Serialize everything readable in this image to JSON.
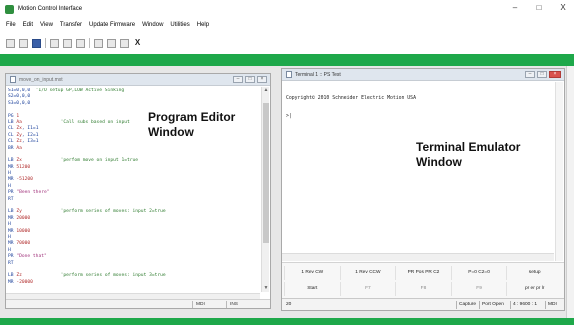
{
  "window": {
    "title": "Motion Control Interface",
    "controls": [
      "–",
      "□",
      "X"
    ]
  },
  "menu": [
    "File",
    "Edit",
    "View",
    "Transfer",
    "Update Firmware",
    "Window",
    "Utilities",
    "Help"
  ],
  "toolbar": {
    "close_label": "X"
  },
  "editor": {
    "title": "move_on_input.mxt",
    "lines": [
      [
        {
          "c": "kw",
          "t": "S1=0,0,0  "
        },
        {
          "c": "cm",
          "t": "'I/O setup GP,LOW Active Sinking"
        }
      ],
      [
        {
          "c": "kw",
          "t": "S2=0,0,0"
        }
      ],
      [
        {
          "c": "kw",
          "t": "S3=0,0,0"
        }
      ],
      [
        {
          "c": "kw",
          "t": ""
        }
      ],
      [
        {
          "c": "kw",
          "t": "PG "
        },
        {
          "c": "val",
          "t": "1"
        }
      ],
      [
        {
          "c": "kw",
          "t": "LB "
        },
        {
          "c": "val",
          "t": "Aa"
        },
        {
          "c": "kw",
          "t": "              "
        },
        {
          "c": "cm",
          "t": "'Call subs based on input"
        }
      ],
      [
        {
          "c": "kw",
          "t": "CL "
        },
        {
          "c": "val",
          "t": "Zx"
        },
        {
          "c": "kw",
          "t": ", I1=1"
        }
      ],
      [
        {
          "c": "kw",
          "t": "CL "
        },
        {
          "c": "val",
          "t": "Zy"
        },
        {
          "c": "kw",
          "t": ", I2=1"
        }
      ],
      [
        {
          "c": "kw",
          "t": "CL "
        },
        {
          "c": "val",
          "t": "Zz"
        },
        {
          "c": "kw",
          "t": ", I3=1"
        }
      ],
      [
        {
          "c": "kw",
          "t": "BR "
        },
        {
          "c": "val",
          "t": "Aa"
        }
      ],
      [
        {
          "c": "kw",
          "t": ""
        }
      ],
      [
        {
          "c": "kw",
          "t": "LB "
        },
        {
          "c": "val",
          "t": "Zx"
        },
        {
          "c": "kw",
          "t": "              "
        },
        {
          "c": "cm",
          "t": "'perfom move on input 1=true"
        }
      ],
      [
        {
          "c": "kw",
          "t": "MR "
        },
        {
          "c": "val",
          "t": "51200"
        }
      ],
      [
        {
          "c": "kw",
          "t": "H"
        }
      ],
      [
        {
          "c": "kw",
          "t": "MR "
        },
        {
          "c": "val",
          "t": "-51200"
        }
      ],
      [
        {
          "c": "kw",
          "t": "H"
        }
      ],
      [
        {
          "c": "kw",
          "t": "PR "
        },
        {
          "c": "str",
          "t": "\"Been there\""
        }
      ],
      [
        {
          "c": "kw",
          "t": "RT"
        }
      ],
      [
        {
          "c": "kw",
          "t": ""
        }
      ],
      [
        {
          "c": "kw",
          "t": "LB "
        },
        {
          "c": "val",
          "t": "Zy"
        },
        {
          "c": "kw",
          "t": "              "
        },
        {
          "c": "cm",
          "t": "'perform series of moves: input 2=true"
        }
      ],
      [
        {
          "c": "kw",
          "t": "MR "
        },
        {
          "c": "val",
          "t": "20000"
        }
      ],
      [
        {
          "c": "kw",
          "t": "H"
        }
      ],
      [
        {
          "c": "kw",
          "t": "MR "
        },
        {
          "c": "val",
          "t": "10000"
        }
      ],
      [
        {
          "c": "kw",
          "t": "H"
        }
      ],
      [
        {
          "c": "kw",
          "t": "MR "
        },
        {
          "c": "val",
          "t": "70000"
        }
      ],
      [
        {
          "c": "kw",
          "t": "H"
        }
      ],
      [
        {
          "c": "kw",
          "t": "PR "
        },
        {
          "c": "str",
          "t": "\"Done that\""
        }
      ],
      [
        {
          "c": "kw",
          "t": "RT"
        }
      ],
      [
        {
          "c": "kw",
          "t": ""
        }
      ],
      [
        {
          "c": "kw",
          "t": "LB "
        },
        {
          "c": "val",
          "t": "Zz"
        },
        {
          "c": "kw",
          "t": "              "
        },
        {
          "c": "cm",
          "t": "'perform series of moves: input 3=true"
        }
      ],
      [
        {
          "c": "kw",
          "t": "MR "
        },
        {
          "c": "val",
          "t": "-20000"
        }
      ]
    ],
    "status": {
      "mode": "MDI",
      "ins": "INS"
    }
  },
  "labels": {
    "program_editor_line1": "Program Editor",
    "program_editor_line2": "Window",
    "terminal_emulator_line1": "Terminal Emulator",
    "terminal_emulator_line2": "Window"
  },
  "terminal": {
    "title": "Terminal 1 :: PS Test",
    "output_line1": "Copyright© 2010 Schneider Electric Motion USA",
    "output_line2": ">|",
    "fkeys_row1": [
      "1 Rev CW",
      "1 Rev CCW",
      "PR Pos PR C2",
      "P=0 C2=0",
      "setup"
    ],
    "fkeys_row2": [
      "Start",
      "F7",
      "F8",
      "F9",
      "pr er pr lr"
    ],
    "status": {
      "line": "20",
      "capture": "Capture",
      "port": "Port Open",
      "baud": "4 : 9600 : 1",
      "mode": "MDI"
    }
  }
}
